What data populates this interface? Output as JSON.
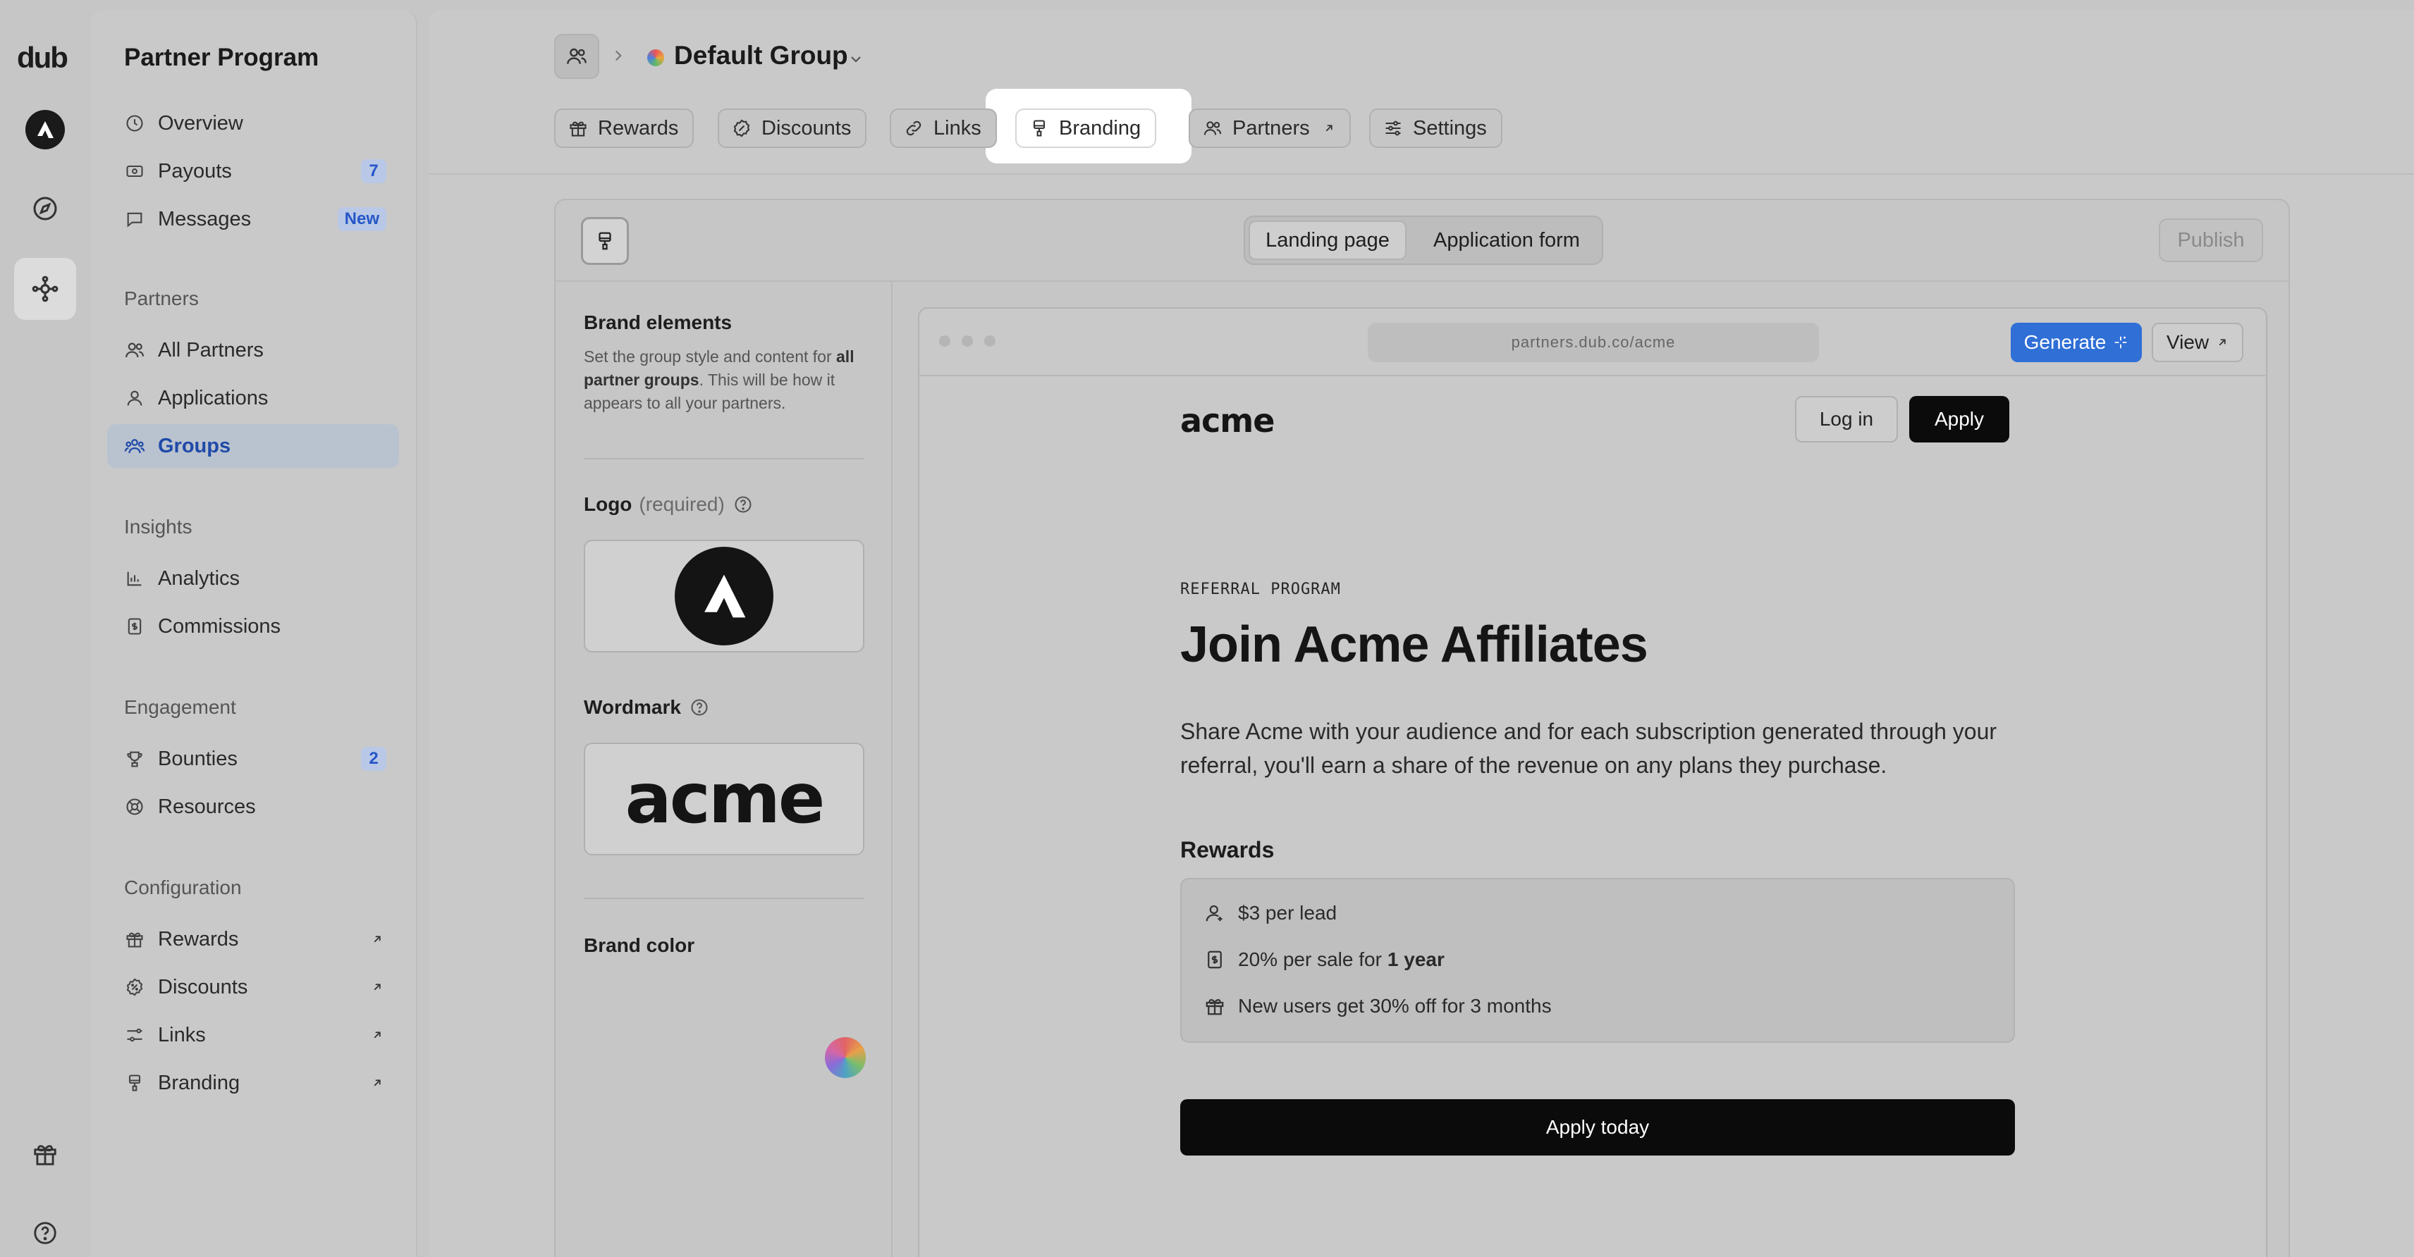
{
  "rail": {
    "logo": "dub",
    "items": [
      {
        "icon": "workspace-avatar-icon"
      },
      {
        "icon": "compass-icon"
      },
      {
        "icon": "partner-program-icon",
        "active": true
      }
    ],
    "bottom": [
      {
        "icon": "gift-icon"
      },
      {
        "icon": "help-icon"
      }
    ]
  },
  "sidebar": {
    "title": "Partner Program",
    "top_items": [
      {
        "label": "Overview",
        "icon": "overview-icon"
      },
      {
        "label": "Payouts",
        "icon": "payouts-icon",
        "badge": "7"
      },
      {
        "label": "Messages",
        "icon": "messages-icon",
        "badge": "New"
      }
    ],
    "sections": [
      {
        "label": "Partners",
        "items": [
          {
            "label": "All Partners",
            "icon": "users-icon"
          },
          {
            "label": "Applications",
            "icon": "user-icon"
          },
          {
            "label": "Groups",
            "icon": "users-group-icon",
            "active": true
          }
        ]
      },
      {
        "label": "Insights",
        "items": [
          {
            "label": "Analytics",
            "icon": "bar-chart-icon"
          },
          {
            "label": "Commissions",
            "icon": "receipt-dollar-icon"
          }
        ]
      },
      {
        "label": "Engagement",
        "items": [
          {
            "label": "Bounties",
            "icon": "trophy-icon",
            "badge": "2"
          },
          {
            "label": "Resources",
            "icon": "resources-icon"
          }
        ]
      },
      {
        "label": "Configuration",
        "items": [
          {
            "label": "Rewards",
            "icon": "gift-icon",
            "external": true
          },
          {
            "label": "Discounts",
            "icon": "discount-icon",
            "external": true
          },
          {
            "label": "Links",
            "icon": "sliders-icon",
            "external": true
          },
          {
            "label": "Branding",
            "icon": "paint-brush-icon",
            "external": true
          }
        ]
      }
    ]
  },
  "header": {
    "group_name": "Default Group",
    "tabs": [
      {
        "label": "Rewards",
        "icon": "gift-icon"
      },
      {
        "label": "Discounts",
        "icon": "discount-icon"
      },
      {
        "label": "Links",
        "icon": "link-icon"
      },
      {
        "label": "Branding",
        "icon": "paint-brush-icon",
        "active": true
      },
      {
        "label": "Partners",
        "icon": "users-icon",
        "external": true
      },
      {
        "label": "Settings",
        "icon": "settings-sliders-icon"
      }
    ]
  },
  "editor": {
    "modes": [
      "Landing page",
      "Application form"
    ],
    "active_mode": "Landing page",
    "publish_label": "Publish",
    "panel": {
      "heading": "Brand elements",
      "desc_prefix": "Set the group style and content for ",
      "desc_bold": "all partner groups",
      "desc_suffix": ". This will be how it appears to all your partners.",
      "logo_label": "Logo",
      "logo_required": "(required)",
      "wordmark_label": "Wordmark",
      "wordmark_text": "acme",
      "brand_color_label": "Brand color"
    },
    "preview": {
      "url": "partners.dub.co/acme",
      "generate_label": "Generate",
      "view_label": "View",
      "wordmark": "acme",
      "login_label": "Log in",
      "apply_label": "Apply",
      "eyebrow": "REFERRAL PROGRAM",
      "title": "Join Acme Affiliates",
      "description": "Share Acme with your audience and for each subscription generated through your referral, you'll earn a share of the revenue on any plans they purchase.",
      "rewards_heading": "Rewards",
      "rewards": [
        {
          "icon": "user-icon",
          "text": "$3 per lead",
          "bold": ""
        },
        {
          "icon": "receipt-dollar-icon",
          "text": "20% per sale for",
          "bold": "1 year"
        },
        {
          "icon": "gift-icon",
          "text": "New users get 30% off for 3 months",
          "bold": ""
        }
      ],
      "cta_label": "Apply today"
    }
  },
  "colors": {
    "accent_blue": "#2f6fd6",
    "active_nav_bg": "#b9c3cf",
    "active_nav_text": "#1f4aa8",
    "cta_black": "#0b0b0b"
  }
}
